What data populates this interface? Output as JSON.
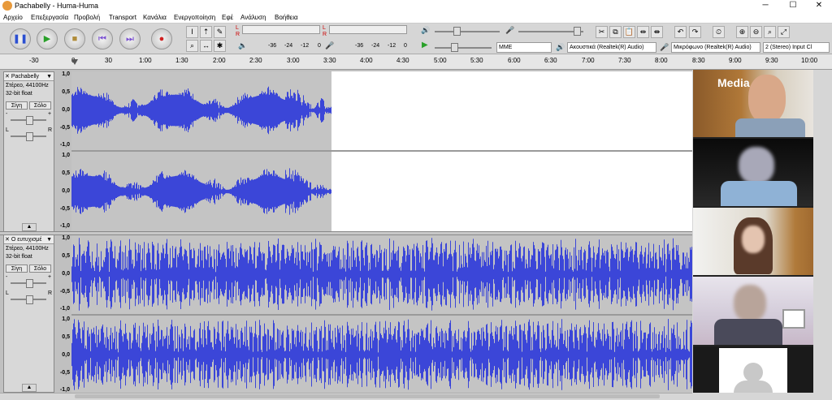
{
  "window": {
    "title": "Pachabelly - Huma-Huma",
    "min": "─",
    "max": "☐",
    "close": "✕"
  },
  "menu": [
    "Αρχείο",
    "Επεξεργασία",
    "Προβολή",
    "Transport",
    "Κανάλια",
    "Ενεργοποίηση",
    "Εφέ",
    "Ανάλυση",
    "Βοήθεια"
  ],
  "meters": {
    "rec_ticks": [
      "-36",
      "-24",
      "-12",
      "0"
    ],
    "play_ticks": [
      "-36",
      "-24",
      "-12",
      "0"
    ],
    "lr_l": "L",
    "lr_r": "R"
  },
  "devices": {
    "host": "MME",
    "output": "Ακουστικά (Realtek(R) Audio)",
    "input": "Μικρόφωνο (Realtek(R) Audio)",
    "channels": "2 (Stereo) Input Cl"
  },
  "ruler": [
    "-30",
    "0",
    "30",
    "1:00",
    "1:30",
    "2:00",
    "2:30",
    "3:00",
    "3:30",
    "4:00",
    "4:30",
    "5:00",
    "5:30",
    "6:00",
    "6:30",
    "7:00",
    "7:30",
    "8:00",
    "8:30",
    "9:00",
    "9:30",
    "10:00"
  ],
  "tracks": [
    {
      "name": "Pachabelly",
      "info1": "Στέρεο, 44100Hz",
      "info2": "32-bit float",
      "mute": "Σίγη",
      "solo": "Σόλο",
      "gain_minus": "-",
      "gain_plus": "+",
      "pan_l": "L",
      "pan_r": "R"
    },
    {
      "name": "Ο ευτυχισμέ",
      "info1": "Στέρεο, 44100Hz",
      "info2": "32-bit float",
      "mute": "Σίγη",
      "solo": "Σόλο",
      "gain_minus": "-",
      "gain_plus": "+",
      "pan_l": "L",
      "pan_r": "R"
    }
  ],
  "scale_ticks": [
    "1,0",
    "0,5",
    "0,0",
    "-0,5",
    "-1,0"
  ],
  "video_tiles": [
    "presenter",
    "participant-2",
    "participant-3",
    "participant-4",
    "participant-5-no-video"
  ],
  "overlay_text": "Media",
  "colors": {
    "wave": "#3b46d8",
    "wave_dark": "#2a30b8",
    "clip_bg": "#c4c4c4",
    "select_bg": "#ffffff"
  }
}
